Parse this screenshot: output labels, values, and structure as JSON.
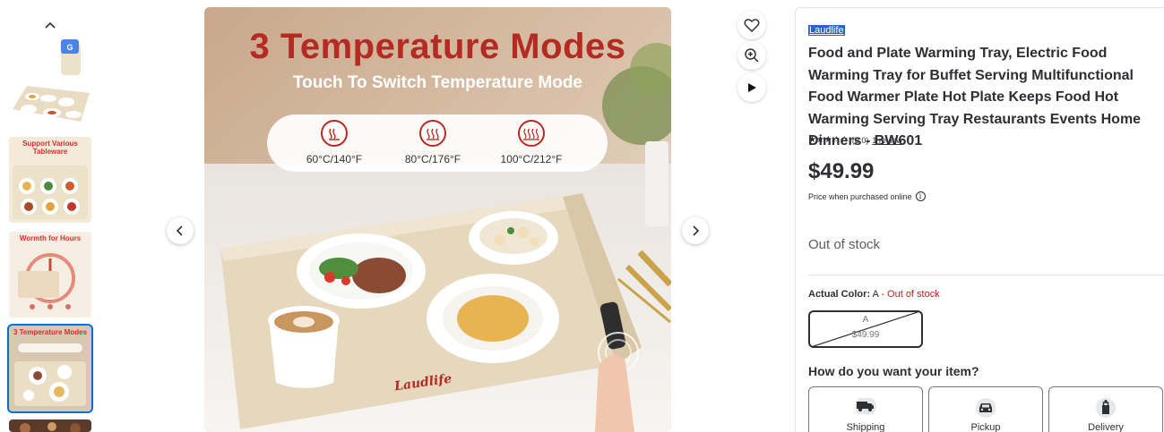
{
  "gallery": {
    "thumbnails": [
      {
        "caption": ""
      },
      {
        "caption": "Support Various Tableware"
      },
      {
        "caption": "Wormth for Hours"
      },
      {
        "caption": "3 Temperature Modes"
      },
      {
        "caption": ""
      }
    ],
    "main_image": {
      "headline": "3 Temperature Modes",
      "subheadline": "Touch To Switch Temperature Mode",
      "modes": [
        {
          "label": "60°C/140°F"
        },
        {
          "label": "80°C/176°F"
        },
        {
          "label": "100°C/212°F"
        }
      ],
      "tray_logo": "Laudlife"
    }
  },
  "product": {
    "brand": "Laudlife",
    "title": "Food and Plate Warming Tray, Electric Food Warming Tray for Buffet Serving Multifunctional Food Warmer Plate Hot Plate Keeps Food Hot Warming Serving Tray Restaurants Events Home Dinners - BW601",
    "rating_stars": "★★★☆☆",
    "rating_value": "(3.0)",
    "review_link": "1 review",
    "price": "$49.99",
    "price_note": "Price when purchased online",
    "stock_status": "Out of stock",
    "color": {
      "label": "Actual Color:",
      "value": "A",
      "status": "- Out of stock",
      "swatch_name": "A",
      "swatch_price": "$49.99"
    },
    "fulfillment": {
      "question": "How do you want your item?",
      "options": [
        {
          "label": "Shipping"
        },
        {
          "label": "Pickup"
        },
        {
          "label": "Delivery"
        }
      ]
    }
  },
  "colors": {
    "accent": "#0071dc",
    "headline_red": "#b52a22",
    "text": "#2e2f32"
  }
}
